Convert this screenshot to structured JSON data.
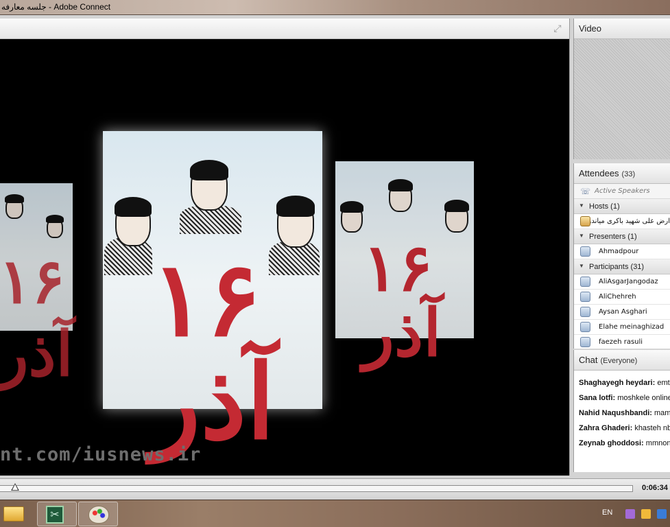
{
  "window": {
    "title": "جلسه معارفه - Adobe Connect"
  },
  "share_pod": {
    "fullscreen_icon": "fullscreen-icon",
    "watermark": "nt.com/iusnews.ir",
    "poster_text": "۱۶ آذر"
  },
  "video_pod": {
    "title": "Video"
  },
  "attendees_pod": {
    "title": "Attendees",
    "count": "(33)",
    "active_speakers": "Active Speakers",
    "hosts": {
      "label": "Hosts (1)",
      "members": [
        "ارض علی شهید باکری میاندوآب"
      ]
    },
    "presenters": {
      "label": "Presenters (1)",
      "members": [
        "Ahmadpour"
      ]
    },
    "participants": {
      "label": "Participants (31)",
      "members": [
        "AliAsgarJangodaz",
        "AliChehreh",
        "Aysan Asghari",
        "Elahe meinaghizad",
        "faezeh rasuli"
      ]
    }
  },
  "chat_pod": {
    "title": "Chat",
    "scope": "(Everyone)",
    "messages": [
      {
        "sender": "Shaghayegh heydari:",
        "text": "emt"
      },
      {
        "sender": "Sana lotfi:",
        "text": "moshkele online"
      },
      {
        "sender": "Nahid Naqushbandi:",
        "text": "mamu"
      },
      {
        "sender": "Zahra Ghaderi:",
        "text": "khasteh nb"
      },
      {
        "sender": "Zeynab ghoddosi:",
        "text": "mmnon"
      }
    ]
  },
  "playback": {
    "time": "0:06:34",
    "progress": 0.024
  },
  "taskbar": {
    "language": "EN",
    "apps": [
      "file-explorer",
      "adobe-connect",
      "paint"
    ]
  },
  "colors": {
    "poster_red": "#c42a33",
    "host_icon": "#d6a34a"
  }
}
